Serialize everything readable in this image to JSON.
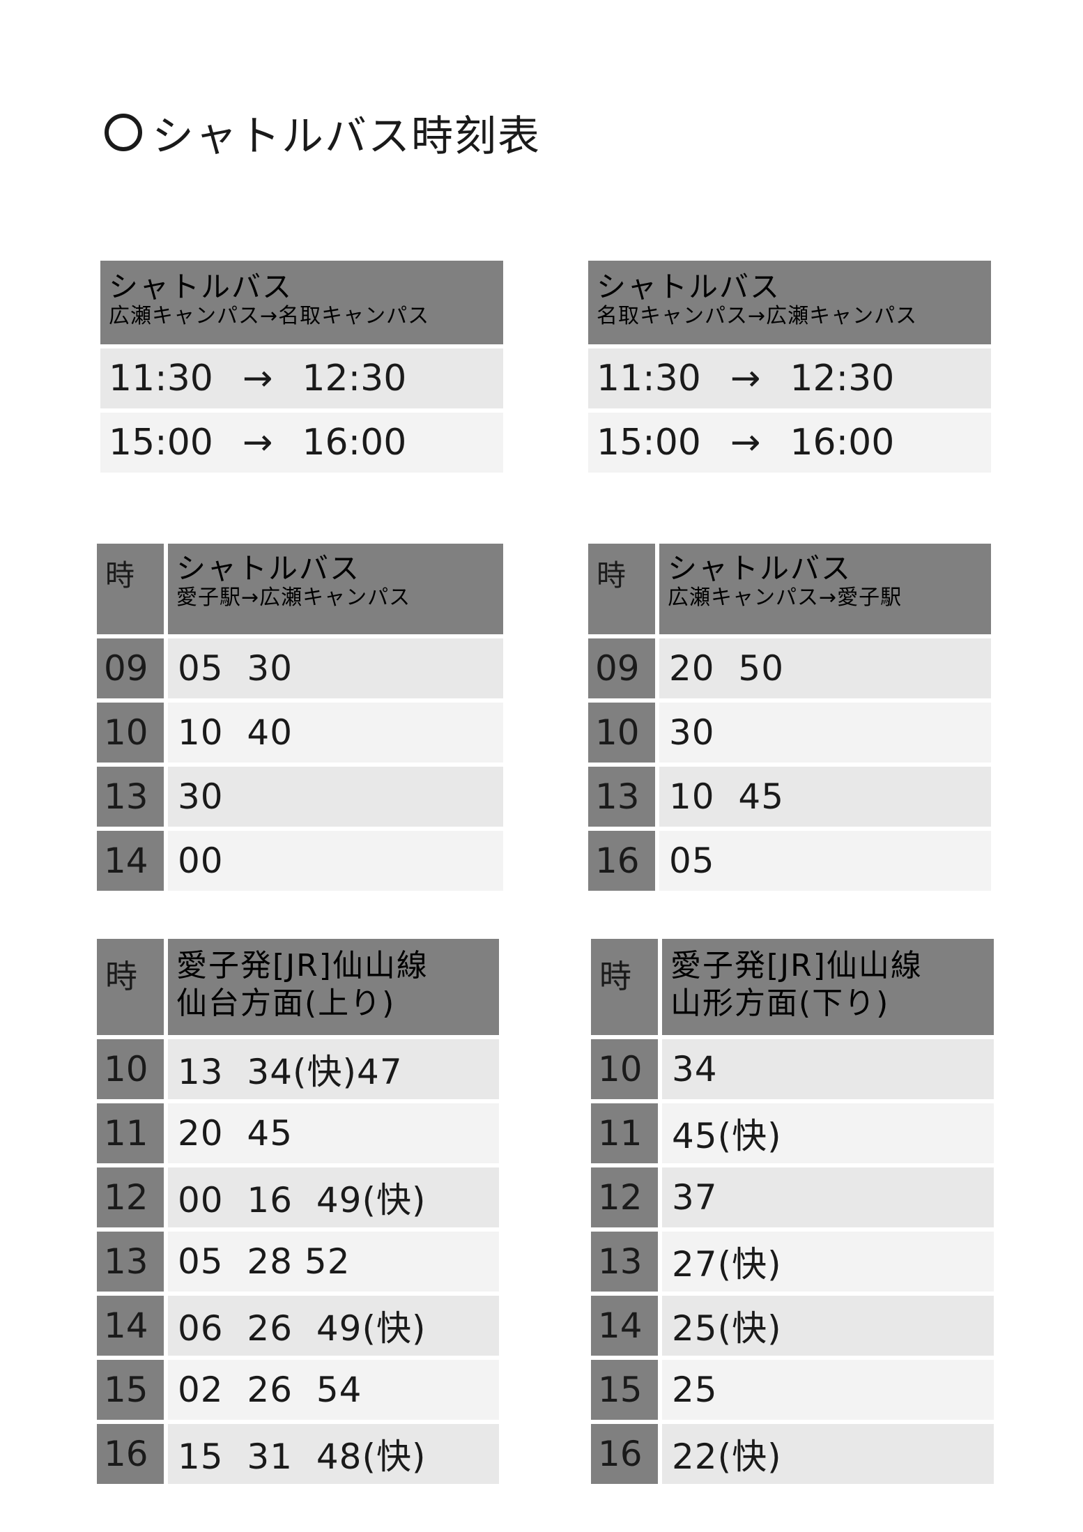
{
  "title": "シャトルバス時刻表",
  "shuttle_left": {
    "name": "シャトルバス",
    "route": "広瀬キャンパス→名取キャンパス",
    "rows": [
      {
        "dep": "11:30",
        "arrow": "→",
        "arr": "12:30"
      },
      {
        "dep": "15:00",
        "arrow": "→",
        "arr": "16:00"
      }
    ]
  },
  "shuttle_right": {
    "name": "シャトルバス",
    "route": "名取キャンパス→広瀬キャンパス",
    "rows": [
      {
        "dep": "11:30",
        "arrow": "→",
        "arr": "12:30"
      },
      {
        "dep": "15:00",
        "arrow": "→",
        "arr": "16:00"
      }
    ]
  },
  "bus_left": {
    "hour_label": "時",
    "name": "シャトルバス",
    "route": "愛子駅→広瀬キャンパス",
    "rows": [
      {
        "hour": "09",
        "times": "05  30"
      },
      {
        "hour": "10",
        "times": "10  40"
      },
      {
        "hour": "13",
        "times": "30"
      },
      {
        "hour": "14",
        "times": "00"
      }
    ]
  },
  "bus_right": {
    "hour_label": "時",
    "name": "シャトルバス",
    "route": "広瀬キャンパス→愛子駅",
    "rows": [
      {
        "hour": "09",
        "times": "20  50"
      },
      {
        "hour": "10",
        "times": "30"
      },
      {
        "hour": "13",
        "times": "10  45"
      },
      {
        "hour": "16",
        "times": "05"
      }
    ]
  },
  "jr_left": {
    "hour_label": "時",
    "name": "愛子発[JR]仙山線",
    "sub": "仙台方面(上り)",
    "rows": [
      {
        "hour": "10",
        "times": "13  34(快)47"
      },
      {
        "hour": "11",
        "times": "20  45"
      },
      {
        "hour": "12",
        "times": "00  16  49(快)"
      },
      {
        "hour": "13",
        "times": "05  28 52"
      },
      {
        "hour": "14",
        "times": "06  26  49(快)"
      },
      {
        "hour": "15",
        "times": "02  26  54"
      },
      {
        "hour": "16",
        "times": "15  31  48(快)"
      }
    ]
  },
  "jr_right": {
    "hour_label": "時",
    "name": "愛子発[JR]仙山線",
    "sub": "山形方面(下り)",
    "rows": [
      {
        "hour": "10",
        "times": "34"
      },
      {
        "hour": "11",
        "times": "45(快)"
      },
      {
        "hour": "12",
        "times": "37"
      },
      {
        "hour": "13",
        "times": "27(快)"
      },
      {
        "hour": "14",
        "times": "25(快)"
      },
      {
        "hour": "15",
        "times": "25"
      },
      {
        "hour": "16",
        "times": "22(快)"
      }
    ]
  },
  "colors": {
    "header_gray": "#808080",
    "row_dark": "#e8e8e8",
    "row_light": "#f3f3f3"
  }
}
